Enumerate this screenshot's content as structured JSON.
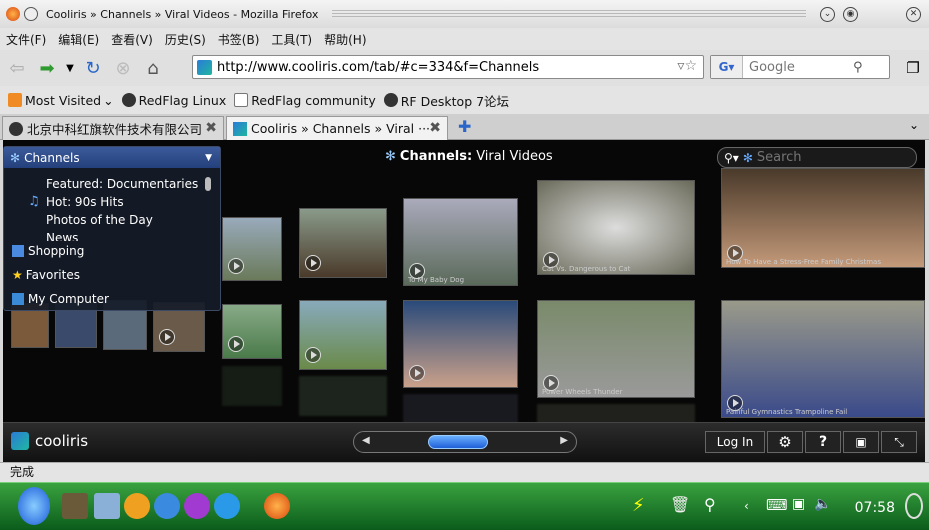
{
  "window": {
    "title": "Cooliris » Channels » Viral Videos - Mozilla Firefox"
  },
  "menubar": [
    "文件(F)",
    "编辑(E)",
    "查看(V)",
    "历史(S)",
    "书签(B)",
    "工具(T)",
    "帮助(H)"
  ],
  "navbar": {
    "url": "http://www.cooliris.com/tab/#c=334&f=Channels",
    "search_placeholder": "Google"
  },
  "bookmarks": [
    "Most Visited",
    "RedFlag Linux",
    "RedFlag community",
    "RF Desktop 7论坛"
  ],
  "tabs": [
    {
      "label": "北京中科红旗软件技术有限公司"
    },
    {
      "label": "Cooliris » Channels » Viral ···"
    }
  ],
  "cooliris": {
    "panel_title": "Channels",
    "channels": [
      "Featured: Documentaries",
      "Hot: 90s Hits",
      "Photos of the Day",
      "News"
    ],
    "sections": [
      "Shopping",
      "Favorites",
      "My Computer"
    ],
    "title_prefix": "Channels:",
    "title_value": "Viral Videos",
    "search_placeholder": "Search",
    "captions": [
      "To My Baby Dog",
      "Cat Vs. Dangerous to Cat",
      "How To Have a Stress-Free Family Christmas",
      "Power Wheels Thunder",
      "Painful Gymnastics Trampoline Fail"
    ],
    "logo": "cooliris",
    "login": "Log In",
    "help": "?"
  },
  "status": "完成",
  "clock": "07:58",
  "colors": {
    "accent": "#2a6fd6",
    "taskbar": "#1f7a2b"
  }
}
